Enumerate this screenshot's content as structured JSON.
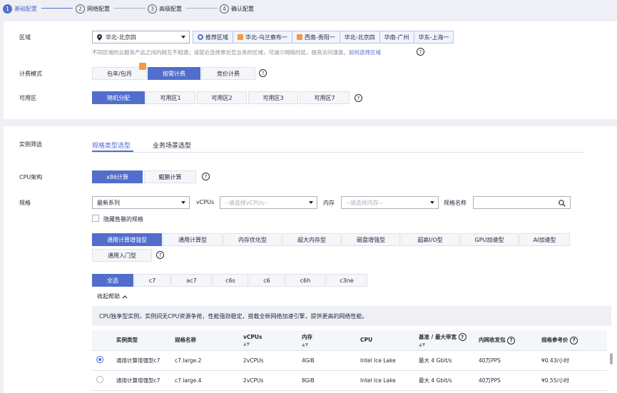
{
  "steps": [
    {
      "num": "1",
      "label": "基础配置"
    },
    {
      "num": "2",
      "label": "网络配置"
    },
    {
      "num": "3",
      "label": "高级配置"
    },
    {
      "num": "4",
      "label": "确认配置"
    }
  ],
  "region": {
    "label": "区域",
    "selected": "华北-北京四",
    "recommend_label": "推荐区域",
    "recommended": [
      "华北-乌兰察布一",
      "西南-贵阳一",
      "华北-北京四",
      "华南-广州",
      "华东-上海一"
    ],
    "hint_text": "不同区域的云服务产品之间内网互不相通；请就近选择靠近您业务的区域，可减少网络时延，提高访问速度。",
    "hint_link": "如何选择区域"
  },
  "billing": {
    "label": "计费模式",
    "options": [
      "包年/包月",
      "按需计费",
      "竞价计费"
    ]
  },
  "az": {
    "label": "可用区",
    "options": [
      "随机分配",
      "可用区1",
      "可用区2",
      "可用区3",
      "可用区7"
    ]
  },
  "filter": {
    "label": "实例筛选",
    "tabs": [
      "规格类型选型",
      "业务场景选型"
    ]
  },
  "cpu_arch": {
    "label": "CPU架构",
    "options": [
      "x86计算",
      "鲲鹏计算"
    ]
  },
  "spec": {
    "label": "规格",
    "series_selected": "最新系列",
    "vcpus_label": "vCPUs",
    "vcpus_placeholder": "--请选择vCPUs--",
    "memory_label": "内存",
    "memory_placeholder": "--请选择内存--",
    "name_label": "规格名称",
    "hide_soldout": "隐藏售罄的规格"
  },
  "type_tabs": [
    "通用计算增强型",
    "通用计算型",
    "内存优化型",
    "超大内存型",
    "磁盘增强型",
    "超高I/O型",
    "GPU加速型",
    "AI加速型",
    "通用入门型"
  ],
  "series_tabs": [
    "全选",
    "c7",
    "ac7",
    "c6s",
    "c6",
    "c6h",
    "c3ne"
  ],
  "collapse_help": "收起帮助",
  "info_text": "CPU独享型实例，实例间无CPU资源争抢，性能强劲稳定，搭载全新网络加速引擎，提供更高的网络性能。",
  "table": {
    "headers": [
      "实例类型",
      "规格名称",
      "vCPUs",
      "内存",
      "CPU",
      "基准 / 最大带宽",
      "内网收发包",
      "规格参考价"
    ],
    "rows": [
      [
        "通用计算增强型c7",
        "c7.large.2",
        "2vCPUs",
        "4GiB",
        "Intel Ice Lake",
        "最大 4 Gbit/s",
        "40万PPS",
        "¥0.43/小时"
      ],
      [
        "通用计算增强型c7",
        "c7.large.4",
        "2vCPUs",
        "8GiB",
        "Intel Ice Lake",
        "最大 4 Gbit/s",
        "40万PPS",
        "¥0.55/小时"
      ]
    ]
  },
  "colors": {
    "accent": "#526ecc",
    "badge": "#f59b3d"
  }
}
